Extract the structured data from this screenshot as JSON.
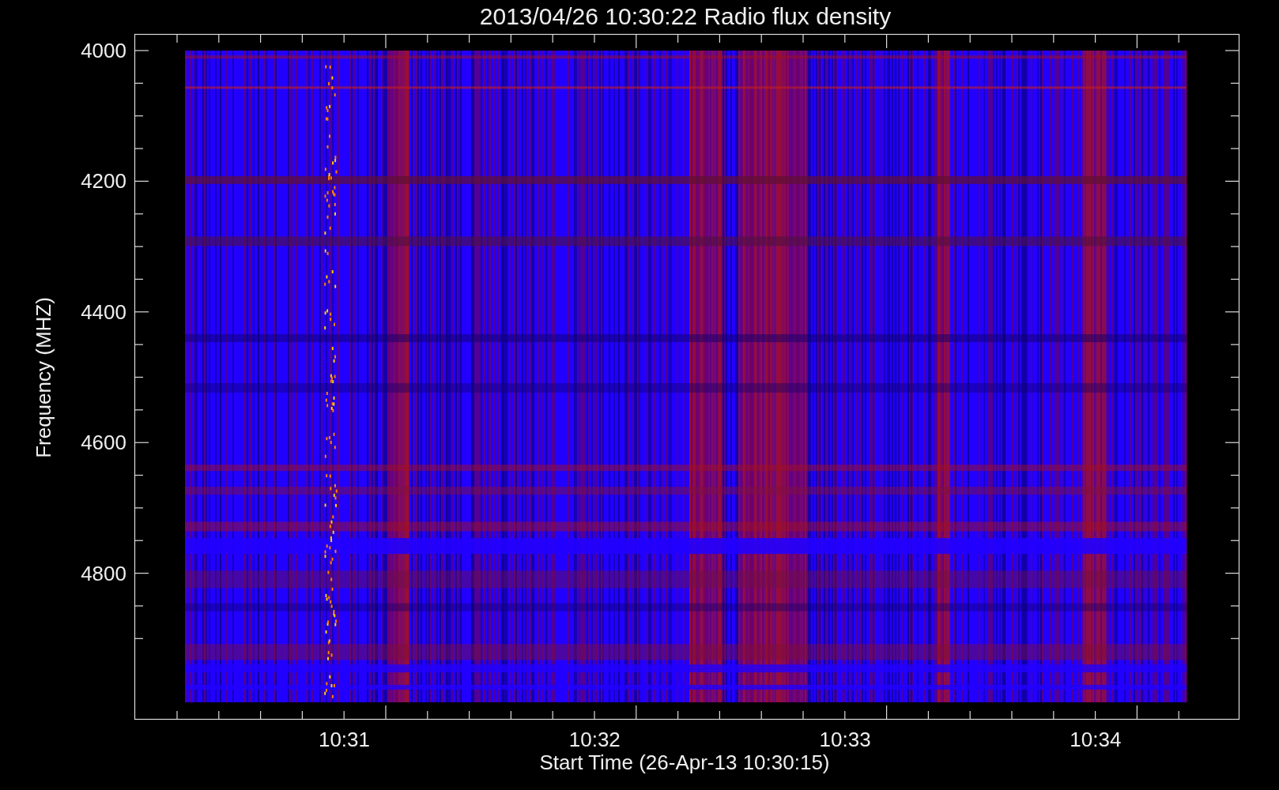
{
  "title": "2013/04/26 10:30:22 Radio flux density",
  "y_axis": {
    "label": "Frequency (MHZ)",
    "ticks": [
      "4000",
      "4200",
      "4400",
      "4600",
      "4800"
    ]
  },
  "x_axis": {
    "label": "Start Time (26-Apr-13 10:30:15)",
    "ticks": [
      "10:31",
      "10:32",
      "10:33",
      "10:34"
    ]
  }
}
